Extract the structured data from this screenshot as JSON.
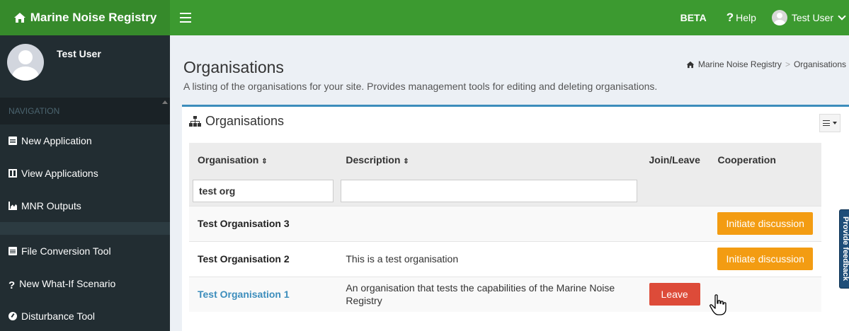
{
  "header": {
    "app_name": "Marine Noise Registry",
    "beta": "BETA",
    "help": "Help",
    "user": "Test User"
  },
  "sidebar": {
    "user": "Test User",
    "nav_header": "NAVIGATION",
    "items": [
      {
        "label": "New Application",
        "icon": "file-icon"
      },
      {
        "label": "View Applications",
        "icon": "table-icon"
      },
      {
        "label": "MNR Outputs",
        "icon": "area-chart-icon"
      },
      {
        "label": "File Conversion Tool",
        "icon": "file-icon"
      },
      {
        "label": "New What-If Scenario",
        "icon": "question-icon"
      },
      {
        "label": "Disturbance Tool",
        "icon": "dashboard-icon"
      }
    ]
  },
  "page": {
    "title": "Organisations",
    "description": "A listing of the organisations for your site. Provides management tools for editing and deleting organisations.",
    "breadcrumb": [
      "Marine Noise Registry",
      "Organisations"
    ]
  },
  "box": {
    "title": "Organisations"
  },
  "table": {
    "columns": [
      "Organisation",
      "Description",
      "Join/Leave",
      "Cooperation"
    ],
    "sort_icon": "⇕",
    "filters": {
      "organisation": "test org",
      "description": ""
    },
    "rows": [
      {
        "name": "Test Organisation 3",
        "description": "",
        "join_leave": "",
        "cooperation": "Initiate discussion"
      },
      {
        "name": "Test Organisation 2",
        "description": "This is a test organisation",
        "join_leave": "",
        "cooperation": "Initiate discussion"
      },
      {
        "name": "Test Organisation 1",
        "description": "An organisation that tests the capabilities of the Marine Noise Registry",
        "join_leave": "Leave",
        "cooperation": ""
      }
    ]
  },
  "feedback": "Provide feedback",
  "colors": {
    "topbar": "#3c9a30",
    "sidebar": "#222d32",
    "accent": "#3c8dbc",
    "orange": "#f39c12",
    "red": "#dd4b39"
  }
}
